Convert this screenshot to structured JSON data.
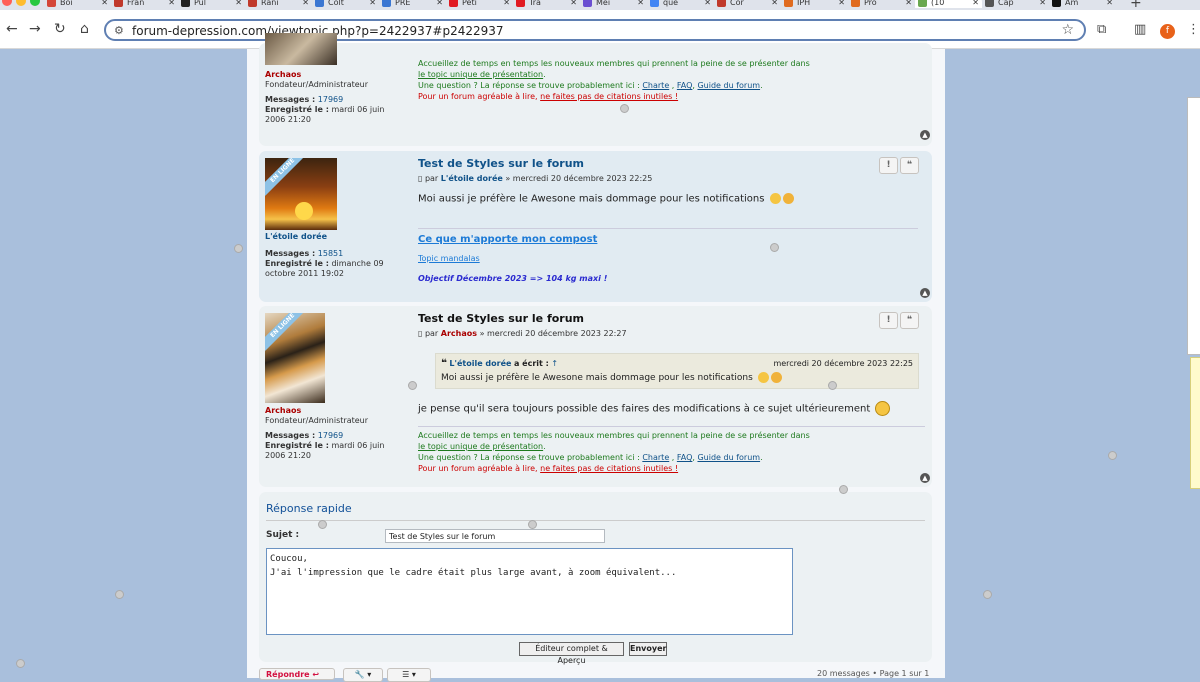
{
  "browser": {
    "tabs": [
      {
        "label": "Boî",
        "color": "#d44638"
      },
      {
        "label": "Fran",
        "color": "#c0392b"
      },
      {
        "label": "Pul",
        "color": "#222222"
      },
      {
        "label": "Rani",
        "color": "#c0392b"
      },
      {
        "label": "Colt",
        "color": "#3b77d2"
      },
      {
        "label": "PRE",
        "color": "#3b77d2"
      },
      {
        "label": "Peti",
        "color": "#e11b22"
      },
      {
        "label": "Tra",
        "color": "#e11b22"
      },
      {
        "label": "Mei",
        "color": "#6a4fd1"
      },
      {
        "label": "que",
        "color": "#4285f4"
      },
      {
        "label": "Cor",
        "color": "#c0392b"
      },
      {
        "label": "IPH",
        "color": "#e06b1f"
      },
      {
        "label": "Pro",
        "color": "#e06b1f"
      },
      {
        "label": "(10",
        "color": "#6aa84f",
        "active": true
      },
      {
        "label": "Cap",
        "color": "#555555"
      },
      {
        "label": "Am",
        "color": "#111111"
      }
    ],
    "url": "forum-depression.com/viewtopic.php?p=2422937#p2422937",
    "profile_initial": "f",
    "colors": {
      "accent": "#105289",
      "red": "#aa0000"
    }
  },
  "post1": {
    "username": "Archaos",
    "rank": "Fondateur/Administrateur",
    "messages_label": "Messages :",
    "messages": "17969",
    "registered_label": "Enregistré le :",
    "registered": "mardi 06 juin 2006 21:20",
    "sig_line1": "Accueillez de temps en temps les nouveaux membres qui prennent la peine de se présenter dans",
    "sig_link1": "le topic unique de présentation",
    "sig_q": "Une question ? La réponse se trouve probablement ici :",
    "sig_charte": "Charte",
    "sig_faq": "FAQ",
    "sig_guide": "Guide du forum",
    "sig_red": "Pour un forum agréable à lire,",
    "sig_red_link": "ne faites pas de citations inutiles !"
  },
  "post2": {
    "badge": "EN LIGNE",
    "username": "L'étoile dorée",
    "messages_label": "Messages :",
    "messages": "15851",
    "registered_label": "Enregistré le :",
    "registered": "dimanche 09 octobre 2011 19:02",
    "title": "Test de Styles sur le forum",
    "by": "par",
    "author": "L'étoile dorée",
    "date": "» mercredi 20 décembre 2023 22:25",
    "text": "Moi aussi je préfère le Awesone mais dommage pour les notifications",
    "sig_link_big": "Ce que m'apporte mon compost",
    "sig_link_small": "Topic mandalas",
    "sig_goal": "Objectif Décembre 2023 => 104 kg maxi !"
  },
  "post3": {
    "badge": "EN LIGNE",
    "username": "Archaos",
    "rank": "Fondateur/Administrateur",
    "messages_label": "Messages :",
    "messages": "17969",
    "registered_label": "Enregistré le :",
    "registered": "mardi 06 juin 2006 21:20",
    "title": "Test de Styles sur le forum",
    "by": "par",
    "author": "Archaos",
    "date": "» mercredi 20 décembre 2023 22:27",
    "quote_author": "L'étoile dorée",
    "quote_wrote": "a écrit :",
    "quote_date": "mercredi 20 décembre 2023 22:25",
    "quote_text": "Moi aussi je préfère le Awesone mais dommage pour les notifications",
    "text": "je pense qu'il sera toujours possible des faires des modifications à ce sujet ultérieurement"
  },
  "reply": {
    "title": "Réponse rapide",
    "subject_label": "Sujet :",
    "subject_value": "Test de Styles sur le forum",
    "message_line1": "Coucou,",
    "message_line2": "J'ai l'impression que le cadre était plus large avant, à zoom équivalent...",
    "full_editor_button": "Éditeur complet & Aperçu",
    "send_button": "Envoyer"
  },
  "footer": {
    "reply_button": "Répondre",
    "pagination": "20 messages • Page 1 sur 1"
  }
}
